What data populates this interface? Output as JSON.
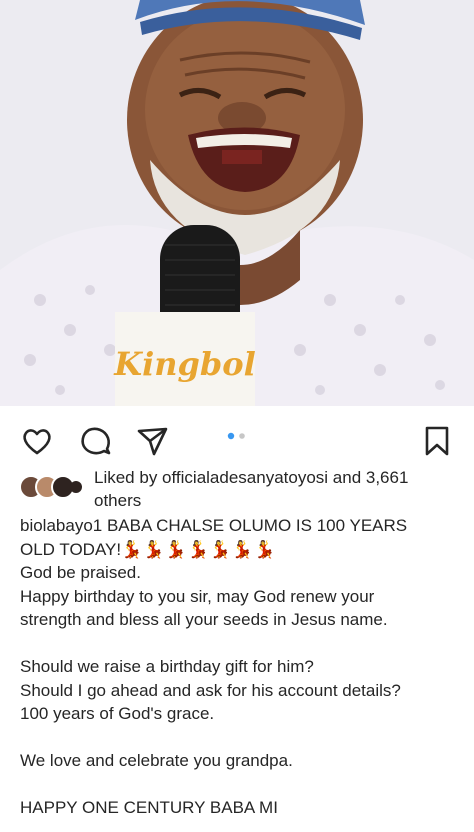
{
  "photo": {
    "mic_logo_text": "Kingbol"
  },
  "actions": {
    "like_icon": "heart-icon",
    "comment_icon": "comment-icon",
    "share_icon": "paper-plane-icon",
    "save_icon": "bookmark-icon",
    "carousel_current": 1,
    "carousel_total": 2
  },
  "likes": {
    "text_line1": "Liked by officialadesanyatoyosi and 3,661",
    "text_line2": "others"
  },
  "caption": {
    "line1": "biolabayo1 BABA CHALSE OLUMO IS 100 YEARS",
    "line2": "OLD TODAY!",
    "emojis": "💃💃💃💃💃💃💃",
    "line3": "God be praised.",
    "line4": "Happy birthday to you sir, may God renew your",
    "line5": "strength and bless all your seeds in Jesus name.",
    "line6": "Should we raise a birthday gift for him?",
    "line7": "Should I go ahead and ask for his account details?",
    "line8": "100 years of God's grace.",
    "line9": "We love and celebrate you grandpa.",
    "line10": "HAPPY ONE CENTURY BABA MI"
  },
  "colors": {
    "text": "#262626",
    "carousel_active": "#3897f0",
    "carousel_inactive": "#c7c7c7"
  }
}
